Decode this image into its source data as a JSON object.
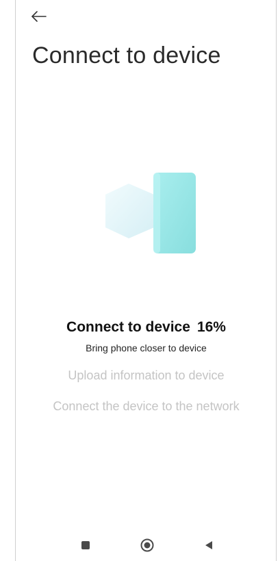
{
  "header": {
    "title": "Connect to device"
  },
  "progress": {
    "active_step_label": "Connect to device",
    "percent_label": "16%",
    "percent_value": 16,
    "hint": "Bring phone closer to device"
  },
  "steps": [
    {
      "label": "Upload information to device",
      "state": "pending"
    },
    {
      "label": "Connect the device to the network",
      "state": "pending"
    }
  ],
  "icons": {
    "back": "back-arrow-icon",
    "illustration": "phone-device-pairing-icon",
    "recents": "recents-square-icon",
    "home": "home-circle-icon",
    "nav_back": "back-triangle-icon"
  },
  "colors": {
    "accent_teal": "#9fe6e6",
    "pending_text": "#c4c4c4",
    "active_text": "#111111"
  }
}
